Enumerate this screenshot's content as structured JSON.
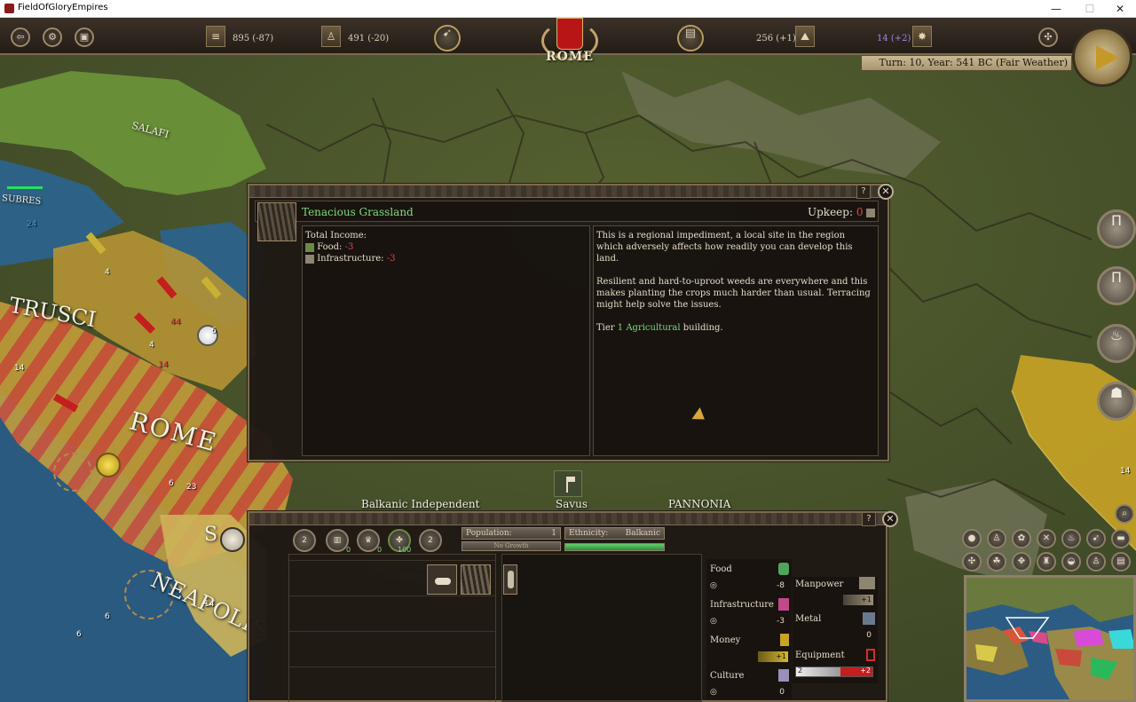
{
  "window": {
    "title": "FieldOfGloryEmpires",
    "minimize": "—",
    "maximize": "☐",
    "close": "✕"
  },
  "topbar": {
    "gold": "895 (-87)",
    "manpower": "491 (-20)",
    "faction": "ROME",
    "metal": "256 (+1)",
    "prestige": "14 (+2)",
    "turn": "Turn: 10, Year: 541 BC (Fair Weather)"
  },
  "map": {
    "labels": {
      "etrusci": "TRUSCI",
      "rome": "ROME",
      "neapolis": "NEAPOLIS",
      "top": "SALAFI",
      "left": "SUBRES",
      "s": "S"
    },
    "region_labels": {
      "balkanic": "Balkanic Independent",
      "savus": "Savus",
      "pannonia": "PANNONIA"
    },
    "unit_numbers": [
      "24",
      "4",
      "4",
      "14",
      "6",
      "44",
      "14",
      "23",
      "6",
      "6",
      "14",
      "14",
      "6"
    ]
  },
  "tooltip": {
    "title": "Tenacious Grassland",
    "upkeep_label": "Upkeep:",
    "upkeep_value": "0",
    "income_header": "Total Income:",
    "food_label": "Food:",
    "food_value": "-3",
    "infra_label": "Infrastructure:",
    "infra_value": "-3",
    "desc_p1": "This is a regional impediment, a local site in the region which adversely affects how readily you can develop this land.",
    "desc_p2": "Resilient and hard-to-uproot weeds are everywhere and this makes planting the crops much harder than usual. Terracing might help solve the issues.",
    "tier_prefix": "Tier",
    "tier_num": "1",
    "tier_type": "Agricultural",
    "tier_suffix": "building.",
    "help": "?",
    "close": "✕"
  },
  "region_panel": {
    "help": "?",
    "close": "✕",
    "circles": [
      {
        "label": "2",
        "num": ""
      },
      {
        "label": "",
        "num": "0"
      },
      {
        "label": "",
        "num": "0"
      },
      {
        "label": "",
        "num": "100"
      },
      {
        "label": "2",
        "num": ""
      }
    ],
    "population_label": "Population:",
    "population_value": "1",
    "growth": "No Growth",
    "ethnicity_label": "Ethnicity:",
    "ethnicity_value": "Balkanic",
    "resources": {
      "food": {
        "label": "Food",
        "value": "-8"
      },
      "infrastructure": {
        "label": "Infrastructure",
        "value": "-3"
      },
      "money": {
        "label": "Money",
        "badge": "+1"
      },
      "culture": {
        "label": "Culture",
        "value": "0"
      },
      "manpower": {
        "label": "Manpower",
        "badge": "+1"
      },
      "metal": {
        "label": "Metal",
        "value": "0"
      },
      "equipment": {
        "label": "Equipment",
        "low": "2",
        "badge": "+2"
      }
    }
  },
  "colors": {
    "accent_green": "#7fdc7b",
    "negative": "#e04848",
    "panel_border": "#7b6a52",
    "rome_red": "#b81616"
  }
}
